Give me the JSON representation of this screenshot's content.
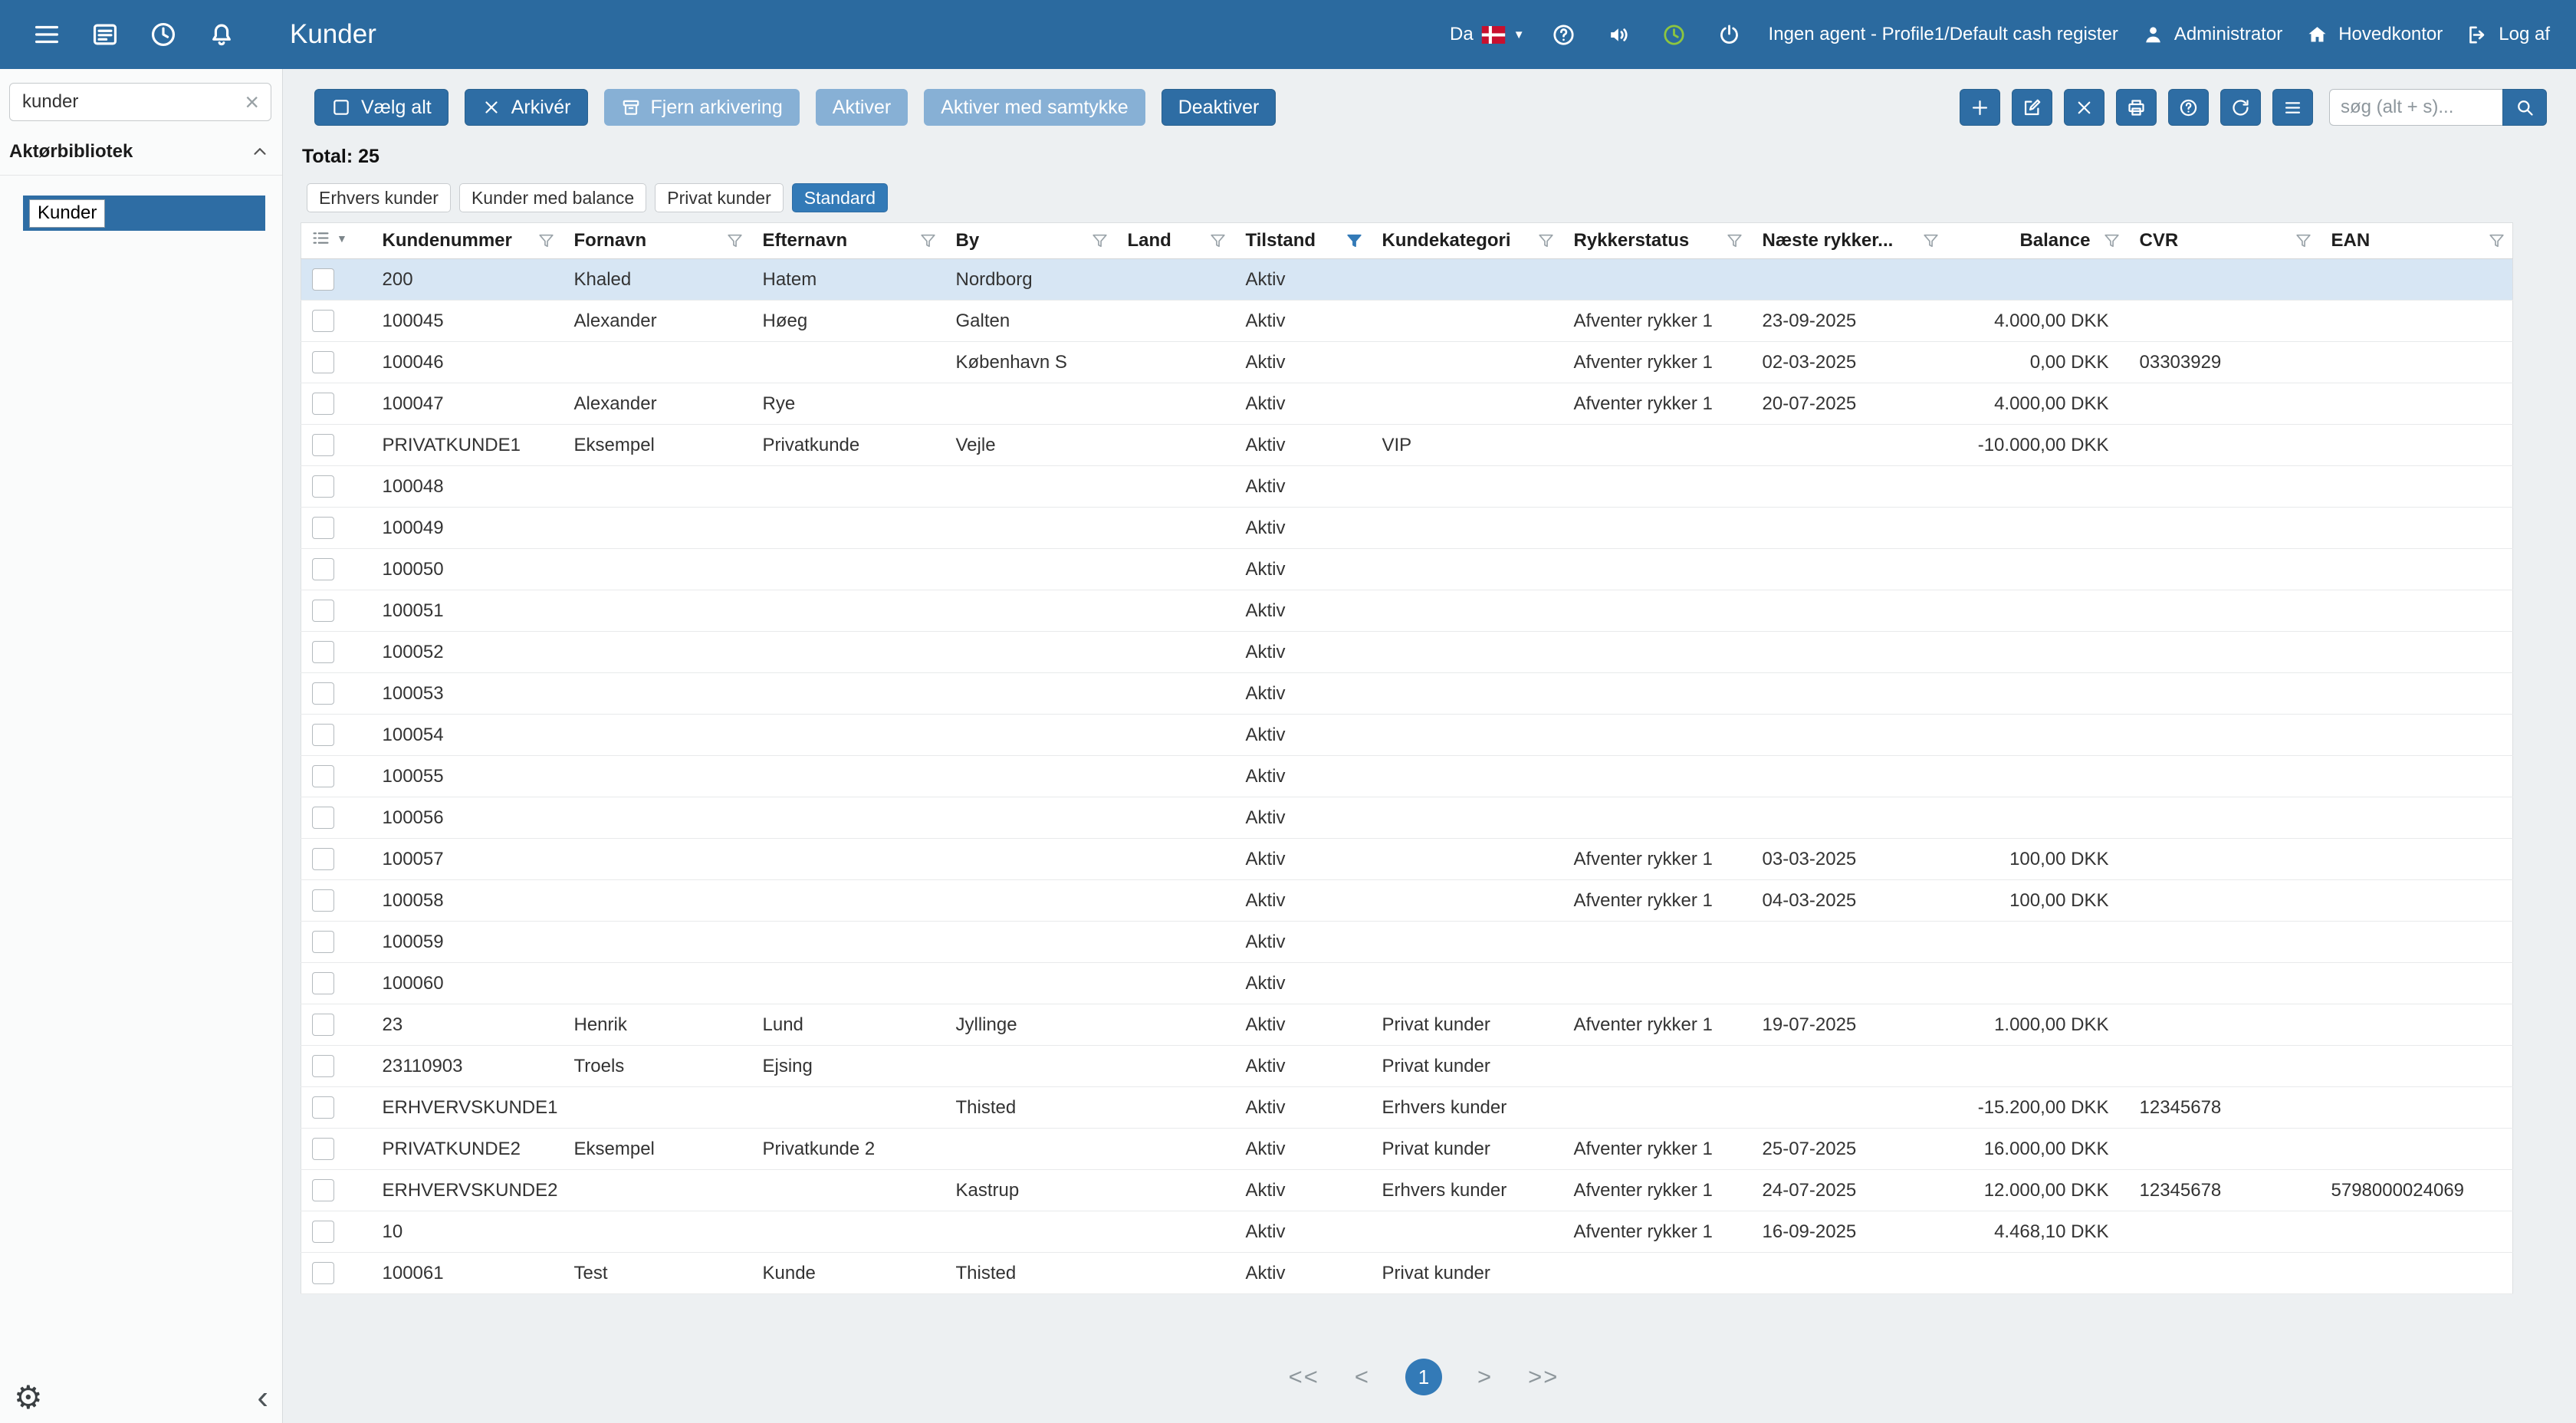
{
  "topbar": {
    "title": "Kunder",
    "language": "Da",
    "agent_status": "Ingen agent - Profile1/Default cash register",
    "user": "Administrator",
    "office": "Hovedkontor",
    "logout": "Log af"
  },
  "sidebar": {
    "search_value": "kunder",
    "section": "Aktørbibliotek",
    "selected_item": "Kunder"
  },
  "toolbar": {
    "buttons": [
      {
        "label": "Vælg alt",
        "enabled": true
      },
      {
        "label": "Arkivér",
        "enabled": true
      },
      {
        "label": "Fjern arkivering",
        "enabled": false
      },
      {
        "label": "Aktiver",
        "enabled": false
      },
      {
        "label": "Aktiver med samtykke",
        "enabled": false
      },
      {
        "label": "Deaktiver",
        "enabled": true
      }
    ],
    "search_placeholder": "søg (alt + s)..."
  },
  "summary": {
    "total": "Total: 25"
  },
  "chips": [
    {
      "label": "Erhvers kunder",
      "active": false
    },
    {
      "label": "Kunder med balance",
      "active": false
    },
    {
      "label": "Privat kunder",
      "active": false
    },
    {
      "label": "Standard",
      "active": true
    }
  ],
  "table": {
    "selected_row_index": 0,
    "columns": [
      {
        "label": "Kundenummer"
      },
      {
        "label": "Fornavn"
      },
      {
        "label": "Efternavn"
      },
      {
        "label": "By"
      },
      {
        "label": "Land"
      },
      {
        "label": "Tilstand",
        "filter_active": true
      },
      {
        "label": "Kundekategori"
      },
      {
        "label": "Rykkerstatus"
      },
      {
        "label": "Næste rykker..."
      },
      {
        "label": "Balance",
        "align": "right"
      },
      {
        "label": "CVR"
      },
      {
        "label": "EAN"
      }
    ],
    "rows": [
      [
        "200",
        "Khaled",
        "Hatem",
        "Nordborg",
        "",
        "Aktiv",
        "",
        "",
        "",
        "",
        "",
        ""
      ],
      [
        "100045",
        "Alexander",
        "Høeg",
        "Galten",
        "",
        "Aktiv",
        "",
        "Afventer rykker 1",
        "23-09-2025",
        "4.000,00 DKK",
        "",
        ""
      ],
      [
        "100046",
        "",
        "",
        "København S",
        "",
        "Aktiv",
        "",
        "Afventer rykker 1",
        "02-03-2025",
        "0,00 DKK",
        "03303929",
        ""
      ],
      [
        "100047",
        "Alexander",
        "Rye",
        "",
        "",
        "Aktiv",
        "",
        "Afventer rykker 1",
        "20-07-2025",
        "4.000,00 DKK",
        "",
        ""
      ],
      [
        "PRIVATKUNDE1",
        "Eksempel",
        "Privatkunde",
        "Vejle",
        "",
        "Aktiv",
        "VIP",
        "",
        "",
        "-10.000,00 DKK",
        "",
        ""
      ],
      [
        "100048",
        "",
        "",
        "",
        "",
        "Aktiv",
        "",
        "",
        "",
        "",
        "",
        ""
      ],
      [
        "100049",
        "",
        "",
        "",
        "",
        "Aktiv",
        "",
        "",
        "",
        "",
        "",
        ""
      ],
      [
        "100050",
        "",
        "",
        "",
        "",
        "Aktiv",
        "",
        "",
        "",
        "",
        "",
        ""
      ],
      [
        "100051",
        "",
        "",
        "",
        "",
        "Aktiv",
        "",
        "",
        "",
        "",
        "",
        ""
      ],
      [
        "100052",
        "",
        "",
        "",
        "",
        "Aktiv",
        "",
        "",
        "",
        "",
        "",
        ""
      ],
      [
        "100053",
        "",
        "",
        "",
        "",
        "Aktiv",
        "",
        "",
        "",
        "",
        "",
        ""
      ],
      [
        "100054",
        "",
        "",
        "",
        "",
        "Aktiv",
        "",
        "",
        "",
        "",
        "",
        ""
      ],
      [
        "100055",
        "",
        "",
        "",
        "",
        "Aktiv",
        "",
        "",
        "",
        "",
        "",
        ""
      ],
      [
        "100056",
        "",
        "",
        "",
        "",
        "Aktiv",
        "",
        "",
        "",
        "",
        "",
        ""
      ],
      [
        "100057",
        "",
        "",
        "",
        "",
        "Aktiv",
        "",
        "Afventer rykker 1",
        "03-03-2025",
        "100,00 DKK",
        "",
        ""
      ],
      [
        "100058",
        "",
        "",
        "",
        "",
        "Aktiv",
        "",
        "Afventer rykker 1",
        "04-03-2025",
        "100,00 DKK",
        "",
        ""
      ],
      [
        "100059",
        "",
        "",
        "",
        "",
        "Aktiv",
        "",
        "",
        "",
        "",
        "",
        ""
      ],
      [
        "100060",
        "",
        "",
        "",
        "",
        "Aktiv",
        "",
        "",
        "",
        "",
        "",
        ""
      ],
      [
        "23",
        "Henrik",
        "Lund",
        "Jyllinge",
        "",
        "Aktiv",
        "Privat kunder",
        "Afventer rykker 1",
        "19-07-2025",
        "1.000,00 DKK",
        "",
        ""
      ],
      [
        "23110903",
        "Troels",
        "Ejsing",
        "",
        "",
        "Aktiv",
        "Privat kunder",
        "",
        "",
        "",
        "",
        ""
      ],
      [
        "ERHVERVSKUNDE1",
        "",
        "",
        "Thisted",
        "",
        "Aktiv",
        "Erhvers kunder",
        "",
        "",
        "-15.200,00 DKK",
        "12345678",
        ""
      ],
      [
        "PRIVATKUNDE2",
        "Eksempel",
        "Privatkunde 2",
        "",
        "",
        "Aktiv",
        "Privat kunder",
        "Afventer rykker 1",
        "25-07-2025",
        "16.000,00 DKK",
        "",
        ""
      ],
      [
        "ERHVERVSKUNDE2",
        "",
        "",
        "Kastrup",
        "",
        "Aktiv",
        "Erhvers kunder",
        "Afventer rykker 1",
        "24-07-2025",
        "12.000,00 DKK",
        "12345678",
        "5798000024069"
      ],
      [
        "10",
        "",
        "",
        "",
        "",
        "Aktiv",
        "",
        "Afventer rykker 1",
        "16-09-2025",
        "4.468,10 DKK",
        "",
        ""
      ],
      [
        "100061",
        "Test",
        "Kunde",
        "Thisted",
        "",
        "Aktiv",
        "Privat kunder",
        "",
        "",
        "",
        "",
        ""
      ]
    ]
  },
  "pagination": {
    "first": "<<",
    "prev": "<",
    "page": "1",
    "next": ">",
    "last": ">>"
  },
  "icons": {
    "clear_search": "×",
    "gear": "⚙",
    "collapse": "‹",
    "caret_down": "▼",
    "caret_up": "chevron-up"
  },
  "colors": {
    "topbar": "#2b6a9f",
    "accent": "#2e6da4",
    "chip_active": "#337ab7",
    "selected_row": "#d7e6f4",
    "disabled_button": "#87b0d5",
    "status_green": "#8dc63f",
    "flag_red": "#c8102e"
  }
}
